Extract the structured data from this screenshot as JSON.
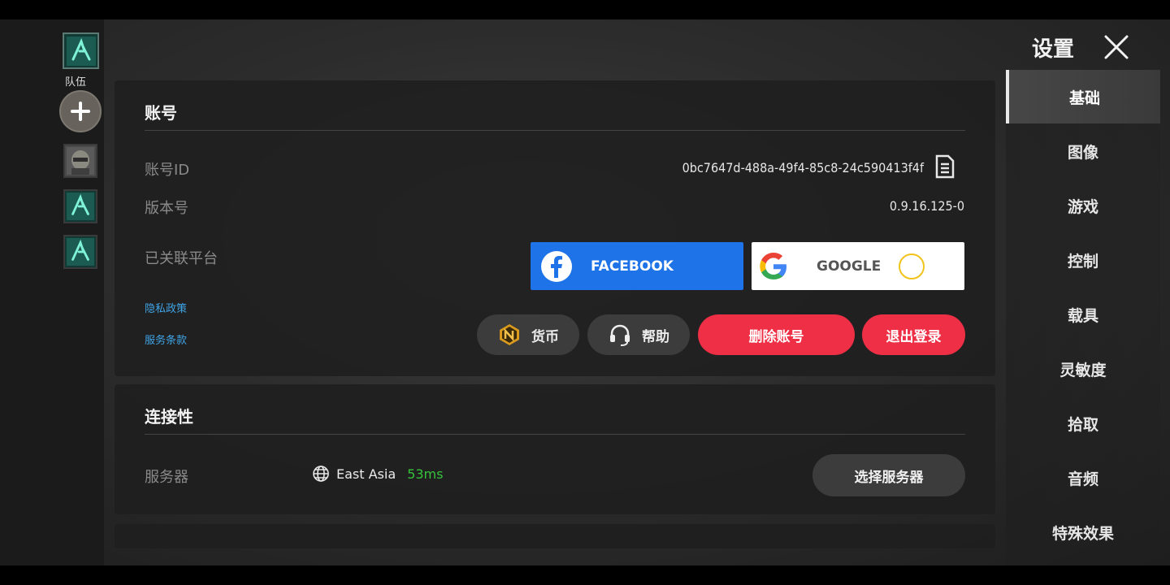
{
  "header": {
    "title": "设置"
  },
  "team": {
    "label": "队伍"
  },
  "nav": {
    "items": [
      {
        "label": "基础",
        "active": true
      },
      {
        "label": "图像",
        "active": false
      },
      {
        "label": "游戏",
        "active": false
      },
      {
        "label": "控制",
        "active": false
      },
      {
        "label": "载具",
        "active": false
      },
      {
        "label": "灵敏度",
        "active": false
      },
      {
        "label": "拾取",
        "active": false
      },
      {
        "label": "音频",
        "active": false
      },
      {
        "label": "特殊效果",
        "active": false
      }
    ]
  },
  "account": {
    "title": "账号",
    "id_label": "账号ID",
    "id_value": "0bc7647d-488a-49f4-85c8-24c590413f4f",
    "version_label": "版本号",
    "version_value": "0.9.16.125-0",
    "platform_label": "已关联平台",
    "facebook_label": "FACEBOOK",
    "google_label": "GOOGLE",
    "privacy_link": "隐私政策",
    "terms_link": "服务条款",
    "currency_label": "货币",
    "help_label": "帮助",
    "delete_label": "删除账号",
    "logout_label": "退出登录"
  },
  "connectivity": {
    "title": "连接性",
    "server_label": "服务器",
    "server_region": "East Asia",
    "server_ping": "53ms",
    "select_server_label": "选择服务器"
  },
  "colors": {
    "accent_red": "#ee2f45",
    "facebook_blue": "#1e73e8",
    "link_blue": "#3fa4e6",
    "ping_green": "#36c23a"
  }
}
